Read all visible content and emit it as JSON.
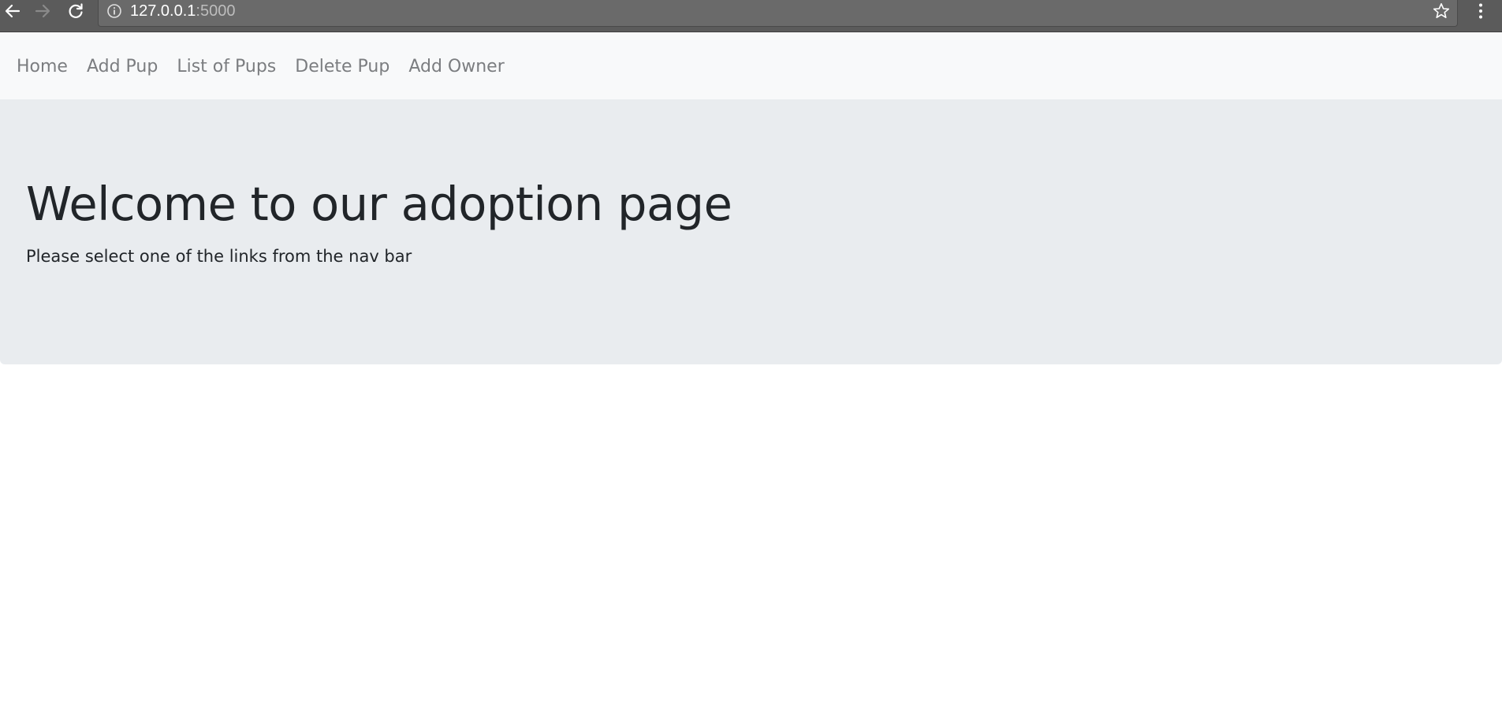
{
  "browser": {
    "url_host": "127.0.0.1",
    "url_port": ":5000",
    "icons": {
      "back": "arrow-left-icon",
      "forward": "arrow-right-icon",
      "reload": "reload-icon",
      "info": "info-icon",
      "bookmark": "star-icon",
      "menu": "kebab-menu-icon"
    }
  },
  "navbar": {
    "items": [
      {
        "label": "Home"
      },
      {
        "label": "Add Pup"
      },
      {
        "label": "List of Pups"
      },
      {
        "label": "Delete Pup"
      },
      {
        "label": "Add Owner"
      }
    ]
  },
  "jumbotron": {
    "title": "Welcome to our adoption page",
    "lead": "Please select one of the links from the nav bar"
  },
  "colors": {
    "chrome": "#5b5b5b",
    "navbar_bg": "#f8f9fa",
    "nav_link": "#7b7d80",
    "jumbotron_bg": "#e9ecef",
    "text": "#212529"
  }
}
